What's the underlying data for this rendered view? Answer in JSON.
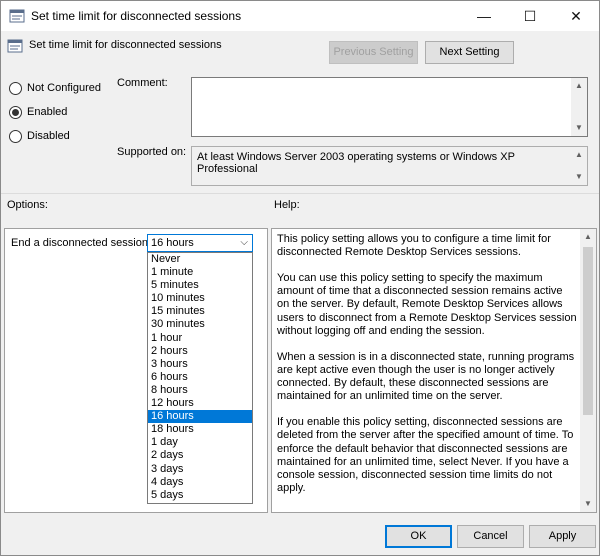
{
  "window": {
    "title": "Set time limit for disconnected sessions",
    "controls": {
      "minimize": "—",
      "maximize": "☐",
      "close": "✕"
    }
  },
  "header": {
    "title": "Set time limit for disconnected sessions",
    "previous_setting": "Previous Setting",
    "next_setting": "Next Setting"
  },
  "state": {
    "options": [
      "Not Configured",
      "Enabled",
      "Disabled"
    ],
    "selected": "Enabled"
  },
  "comment": {
    "label": "Comment:",
    "value": ""
  },
  "supported_on": {
    "label": "Supported on:",
    "value": "At least Windows Server 2003 operating systems or Windows XP Professional"
  },
  "options_section": {
    "label": "Options:",
    "field_label": "End a disconnected session",
    "selected_value": "16 hours",
    "choices": [
      "Never",
      "1 minute",
      "5 minutes",
      "10 minutes",
      "15 minutes",
      "30 minutes",
      "1 hour",
      "2 hours",
      "3 hours",
      "6 hours",
      "8 hours",
      "12 hours",
      "16 hours",
      "18 hours",
      "1 day",
      "2 days",
      "3 days",
      "4 days",
      "5 days"
    ]
  },
  "help_section": {
    "label": "Help:",
    "paragraphs": [
      "This policy setting allows you to configure a time limit for disconnected Remote Desktop Services sessions.",
      "You can use this policy setting to specify the maximum amount of time that a disconnected session remains active on the server. By default, Remote Desktop Services allows users to disconnect from a Remote Desktop Services session without logging off and ending the session.",
      "When a session is in a disconnected state, running programs are kept active even though the user is no longer actively connected. By default, these disconnected sessions are maintained for an unlimited time on the server.",
      "If you enable this policy setting, disconnected sessions are deleted from the server after the specified amount of time. To enforce the default behavior that disconnected sessions are maintained for an unlimited time, select Never. If you have a console session, disconnected session time limits do not apply."
    ]
  },
  "footer": {
    "ok": "OK",
    "cancel": "Cancel",
    "apply": "Apply"
  },
  "colors": {
    "accent": "#0078d7",
    "window_bg": "#f0f0f0"
  }
}
